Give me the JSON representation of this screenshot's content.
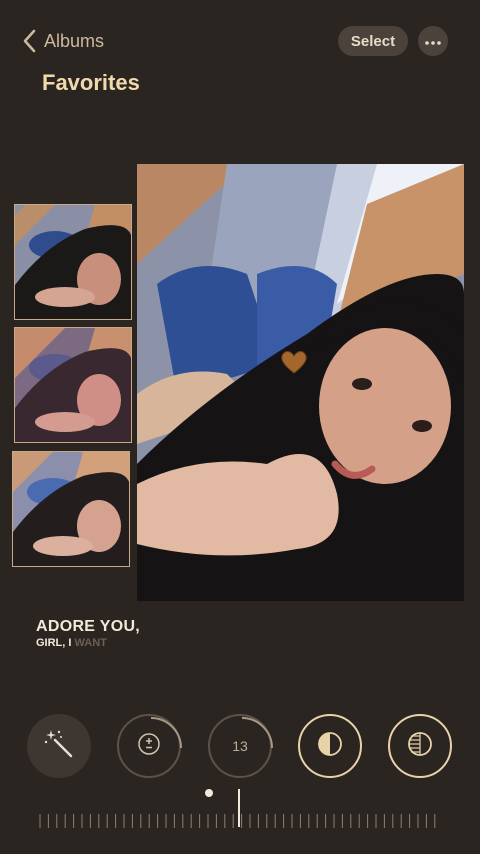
{
  "header": {
    "back_label": "Albums",
    "select_label": "Select",
    "more_icon": "ellipsis-icon",
    "title": "Favorites"
  },
  "caption": {
    "line1": "ADORE YOU,",
    "line2": "GIRL, I",
    "line2_faded": "WANT"
  },
  "tools": {
    "wand_icon": "magic-wand-icon",
    "exposure_icon": "plus-minus-icon",
    "value_label": "13",
    "contrast_icon": "half-circle-icon",
    "bw_icon": "striped-half-circle-icon"
  },
  "colors": {
    "background": "#2b2522",
    "accent": "#e8d2a8"
  }
}
